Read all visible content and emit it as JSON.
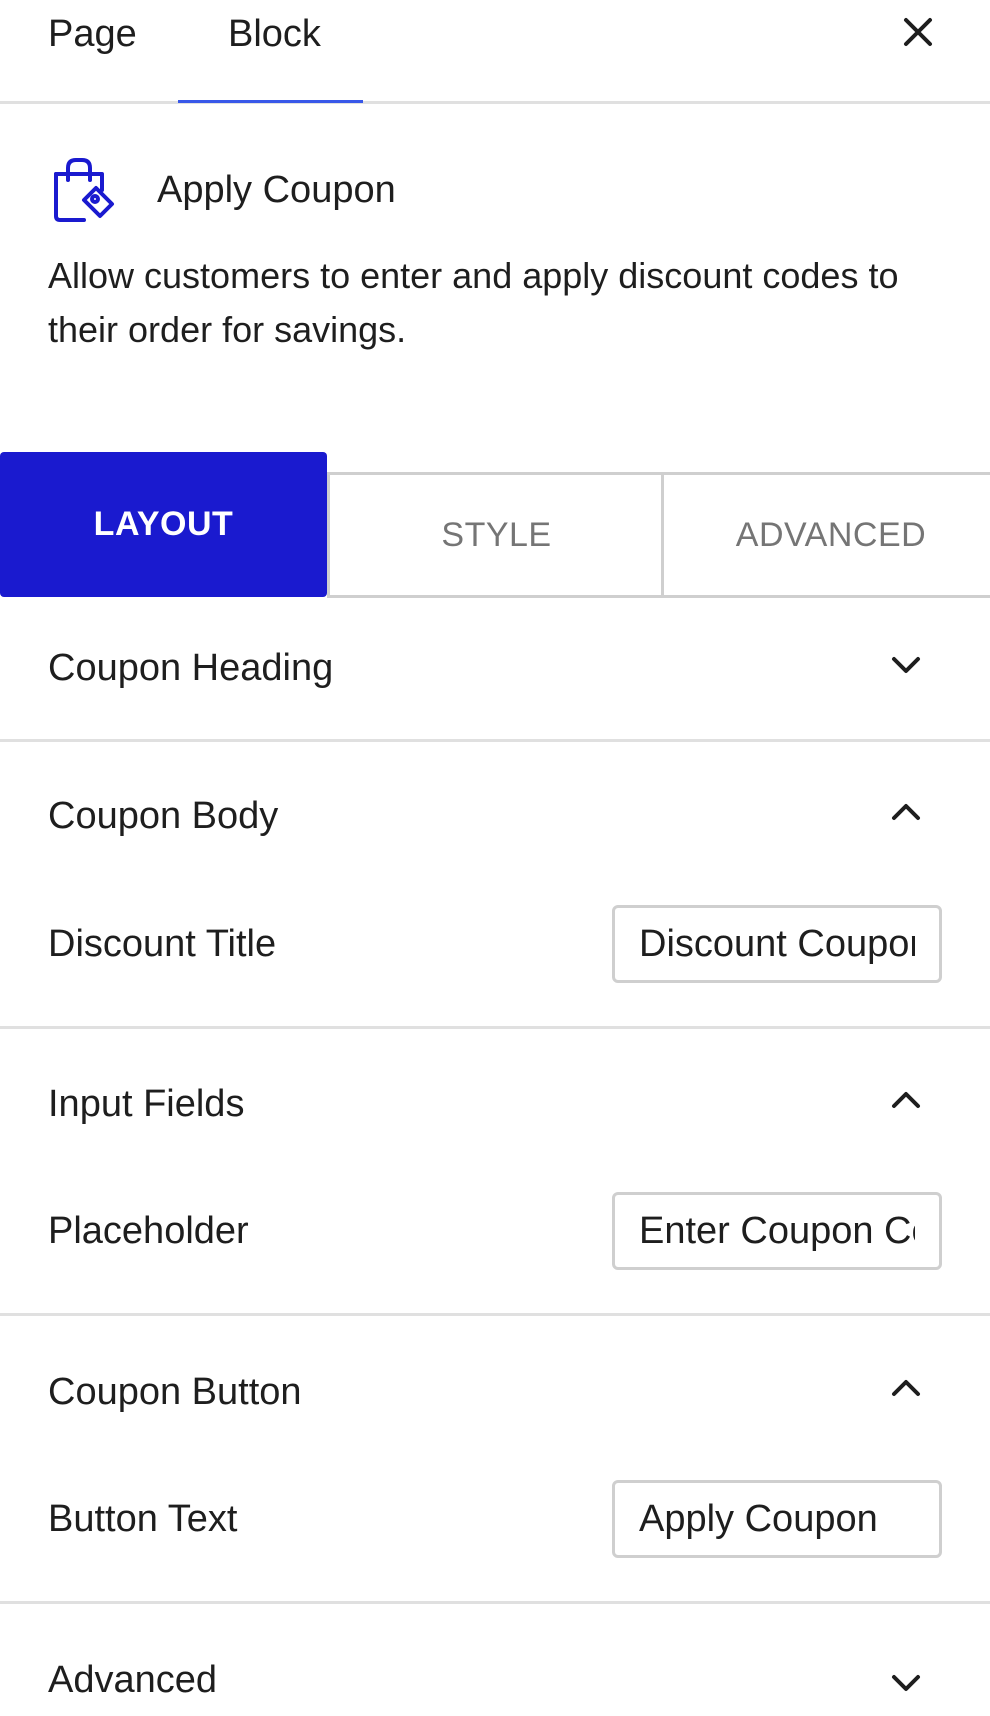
{
  "top_tabs": {
    "page": "Page",
    "block": "Block",
    "active": "Block"
  },
  "close_icon": "close-icon",
  "block": {
    "icon": "shopping-bag-tag-icon",
    "title": "Apply Coupon",
    "description": "Allow customers to enter and apply discount codes to their order for savings."
  },
  "mode_tabs": {
    "layout": "LAYOUT",
    "style": "STYLE",
    "advanced": "ADVANCED",
    "active": "LAYOUT"
  },
  "sections": {
    "coupon_heading": {
      "title": "Coupon Heading",
      "expanded": false
    },
    "coupon_body": {
      "title": "Coupon Body",
      "expanded": true,
      "field_label": "Discount Title",
      "field_value": "Discount Coupon"
    },
    "input_fields": {
      "title": "Input Fields",
      "expanded": true,
      "field_label": "Placeholder",
      "field_value": "Enter Coupon Code"
    },
    "coupon_button": {
      "title": "Coupon Button",
      "expanded": true,
      "field_label": "Button Text",
      "field_value": "Apply Coupon"
    },
    "advanced": {
      "title": "Advanced",
      "expanded": false
    }
  },
  "colors": {
    "accent": "#1a1acf",
    "tab_underline": "#3858e9",
    "border": "#cfcfcf",
    "divider": "#e0e0e0",
    "muted_text": "#757575"
  }
}
